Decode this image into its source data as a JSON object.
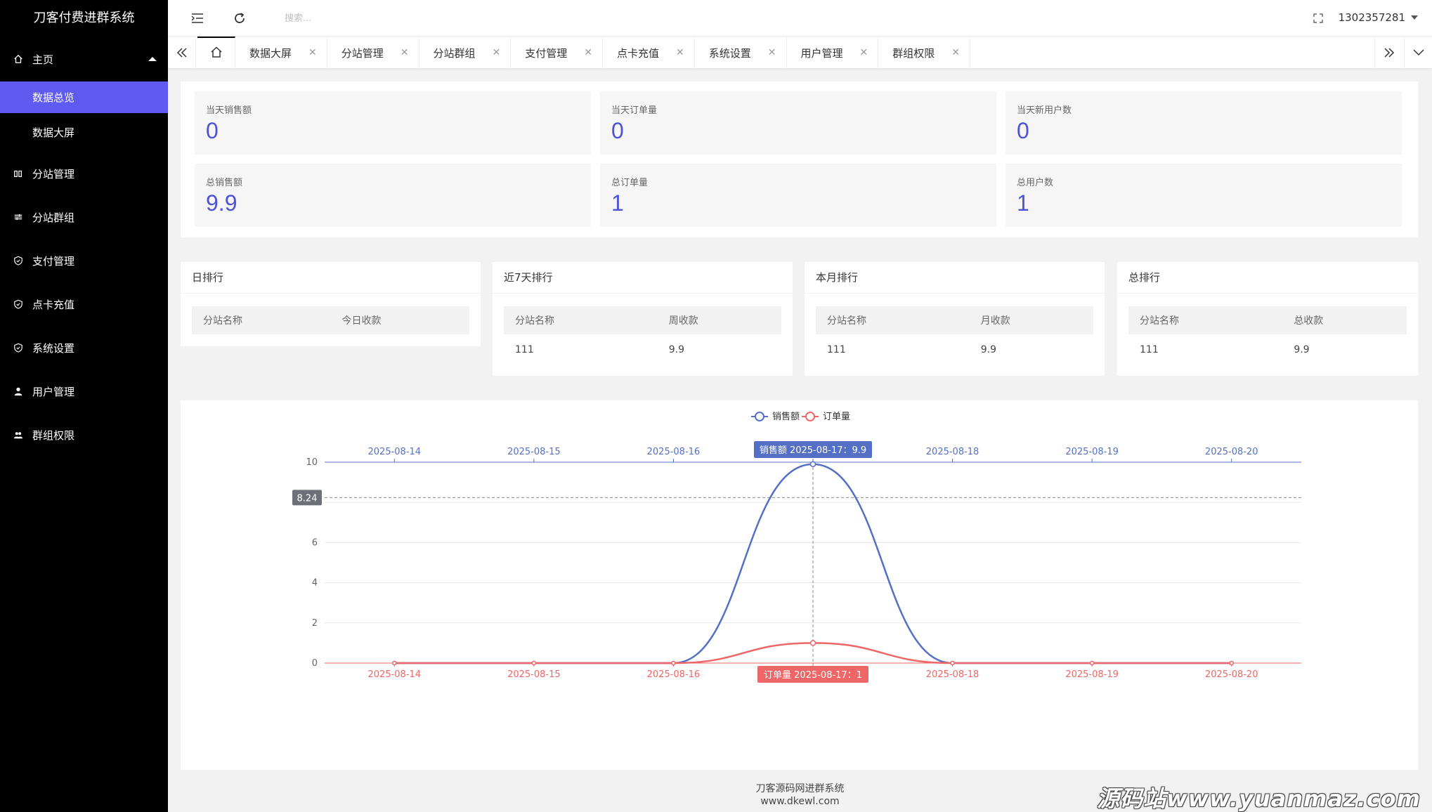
{
  "app": {
    "title": "刀客付费进群系统"
  },
  "sidebar": {
    "home_label": "主页",
    "sub_items": [
      {
        "label": "数据总览",
        "active": true
      },
      {
        "label": "数据大屏",
        "active": false
      }
    ],
    "items": [
      {
        "label": "分站管理",
        "icon": "columns-icon"
      },
      {
        "label": "分站群组",
        "icon": "sliders-icon"
      },
      {
        "label": "支付管理",
        "icon": "shield-icon"
      },
      {
        "label": "点卡充值",
        "icon": "shield-icon"
      },
      {
        "label": "系统设置",
        "icon": "shield-icon"
      },
      {
        "label": "用户管理",
        "icon": "user-icon"
      },
      {
        "label": "群组权限",
        "icon": "users-icon"
      }
    ]
  },
  "header": {
    "search_placeholder": "搜索...",
    "username": "1302357281"
  },
  "tabs": [
    "数据大屏",
    "分站管理",
    "分站群组",
    "支付管理",
    "点卡充值",
    "系统设置",
    "用户管理",
    "群组权限"
  ],
  "stats": [
    {
      "label": "当天销售额",
      "value": "0"
    },
    {
      "label": "当天订单量",
      "value": "0"
    },
    {
      "label": "当天新用户数",
      "value": "0"
    },
    {
      "label": "总销售额",
      "value": "9.9"
    },
    {
      "label": "总订单量",
      "value": "1"
    },
    {
      "label": "总用户数",
      "value": "1"
    }
  ],
  "rankings": [
    {
      "title": "日排行",
      "col1": "分站名称",
      "col2": "今日收款",
      "rows": []
    },
    {
      "title": "近7天排行",
      "col1": "分站名称",
      "col2": "周收款",
      "rows": [
        [
          "111",
          "9.9"
        ]
      ]
    },
    {
      "title": "本月排行",
      "col1": "分站名称",
      "col2": "月收款",
      "rows": [
        [
          "111",
          "9.9"
        ]
      ]
    },
    {
      "title": "总排行",
      "col1": "分站名称",
      "col2": "总收款",
      "rows": [
        [
          "111",
          "9.9"
        ]
      ]
    }
  ],
  "chart_data": {
    "type": "line",
    "categories": [
      "2025-08-14",
      "2025-08-15",
      "2025-08-16",
      "2025-08-17",
      "2025-08-18",
      "2025-08-19",
      "2025-08-20"
    ],
    "series": [
      {
        "name": "销售额",
        "values": [
          0,
          0,
          0,
          9.9,
          0,
          0,
          0
        ],
        "color": "#5470c6"
      },
      {
        "name": "订单量",
        "values": [
          0,
          0,
          0,
          1,
          0,
          0,
          0
        ],
        "color": "#ee6666"
      }
    ],
    "ylim": [
      0,
      10
    ],
    "yticks": [
      0,
      2,
      4,
      6,
      8,
      10
    ],
    "smooth": true,
    "legend": "top-center",
    "grid": true,
    "tooltip": {
      "top_label": "销售额  2025-08-17：9.9",
      "bottom_label": "订单量  2025-08-17：1",
      "y_pointer_value": "8.24"
    }
  },
  "footer": {
    "line1": "刀客源码网进群系统",
    "line2": "www.dkewl.com"
  },
  "watermark": "源码站www.yuanmaz.com"
}
